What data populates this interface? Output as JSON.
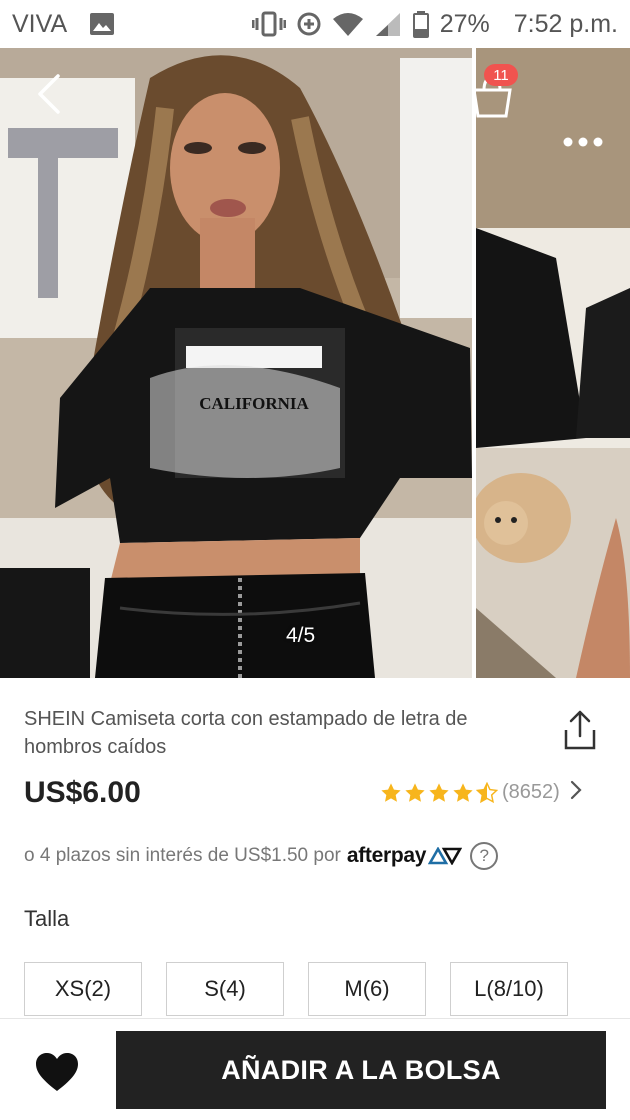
{
  "status_bar": {
    "carrier": "VIVA",
    "battery": "27%",
    "time": "7:52 p.m.",
    "icons": [
      "gallery-icon",
      "vibrate-icon",
      "data-saver-icon",
      "wifi-icon",
      "signal-icon",
      "battery-icon"
    ]
  },
  "gallery": {
    "page_indicator": "4/5",
    "print_text": "CALIFORNIA",
    "bag_count": "11",
    "icons": [
      "back-icon",
      "bag-icon",
      "more-icon"
    ]
  },
  "product": {
    "title": "SHEIN Camiseta corta con estampado de letra de hombros caídos",
    "price": "US$6.00",
    "rating_stars": 4.5,
    "rating_count": "(8652)",
    "installments_text": "o 4 plazos sin interés de US$1.50 por",
    "afterpay_label": "afterpay",
    "help_symbol": "?",
    "size_label": "Talla",
    "sizes": [
      "XS(2)",
      "S(4)",
      "M(6)",
      "L(8/10)"
    ]
  },
  "bottom_bar": {
    "add_to_bag_label": "AÑADIR A LA BOLSA"
  },
  "colors": {
    "accent_badge": "#f0534f",
    "star": "#f7b51c",
    "button_dark": "#222222"
  }
}
